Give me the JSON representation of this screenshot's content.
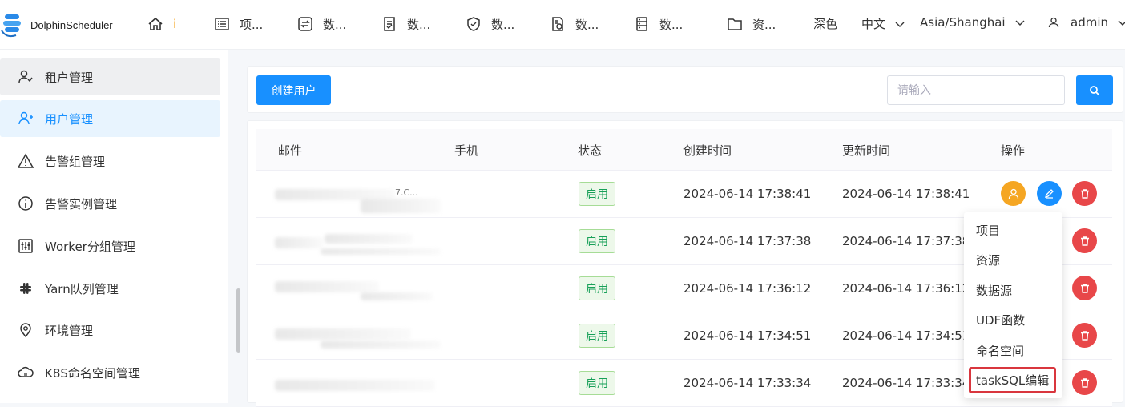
{
  "app": {
    "name": "DolphinScheduler"
  },
  "header": {
    "nav": [
      {
        "label": "i",
        "icon": "home-icon"
      },
      {
        "label": "项...",
        "icon": "list-icon"
      },
      {
        "label": "数...",
        "icon": "exchange-icon"
      },
      {
        "label": "数...",
        "icon": "doc-icon"
      },
      {
        "label": "数...",
        "icon": "shield-icon"
      },
      {
        "label": "数...",
        "icon": "file-gear-icon"
      },
      {
        "label": "数...",
        "icon": "server-icon"
      },
      {
        "label": "资...",
        "icon": "folder-icon"
      }
    ],
    "theme": "深色",
    "language": "中文",
    "timezone": "Asia/Shanghai",
    "user": "admin"
  },
  "sidebar": {
    "items": [
      {
        "label": "租户管理",
        "icon": "tenant-icon",
        "state": "hover"
      },
      {
        "label": "用户管理",
        "icon": "user-add-icon",
        "state": "active"
      },
      {
        "label": "告警组管理",
        "icon": "warning-icon",
        "state": ""
      },
      {
        "label": "告警实例管理",
        "icon": "info-icon",
        "state": ""
      },
      {
        "label": "Worker分组管理",
        "icon": "sliders-icon",
        "state": ""
      },
      {
        "label": "Yarn队列管理",
        "icon": "slack-icon",
        "state": ""
      },
      {
        "label": "环境管理",
        "icon": "location-icon",
        "state": ""
      },
      {
        "label": "K8S命名空间管理",
        "icon": "cloud-icon",
        "state": ""
      }
    ]
  },
  "toolbar": {
    "create_label": "创建用户",
    "search_placeholder": "请输入"
  },
  "table": {
    "columns": [
      "邮件",
      "手机",
      "状态",
      "创建时间",
      "更新时间",
      "操作"
    ],
    "rows": [
      {
        "email": "7.C...",
        "phone": "",
        "status": "启用",
        "created": "2024-06-14 17:38:41",
        "updated": "2024-06-14 17:38:41"
      },
      {
        "email": "",
        "phone": "",
        "status": "启用",
        "created": "2024-06-14 17:37:38",
        "updated": "2024-06-14 17:37:38"
      },
      {
        "email": "",
        "phone": "",
        "status": "启用",
        "created": "2024-06-14 17:36:12",
        "updated": "2024-06-14 17:36:12"
      },
      {
        "email": "",
        "phone": "",
        "status": "启用",
        "created": "2024-06-14 17:34:51",
        "updated": "2024-06-14 17:34:51"
      },
      {
        "email": "",
        "phone": "",
        "status": "启用",
        "created": "2024-06-14 17:33:34",
        "updated": "2024-06-14 17:33:34"
      }
    ]
  },
  "authorize_menu": {
    "items": [
      "项目",
      "资源",
      "数据源",
      "UDF函数",
      "命名空间",
      "taskSQL编辑"
    ]
  },
  "colors": {
    "primary": "#1890ff",
    "success": "#18a058",
    "danger": "#e84749",
    "warning": "#f5a623"
  }
}
